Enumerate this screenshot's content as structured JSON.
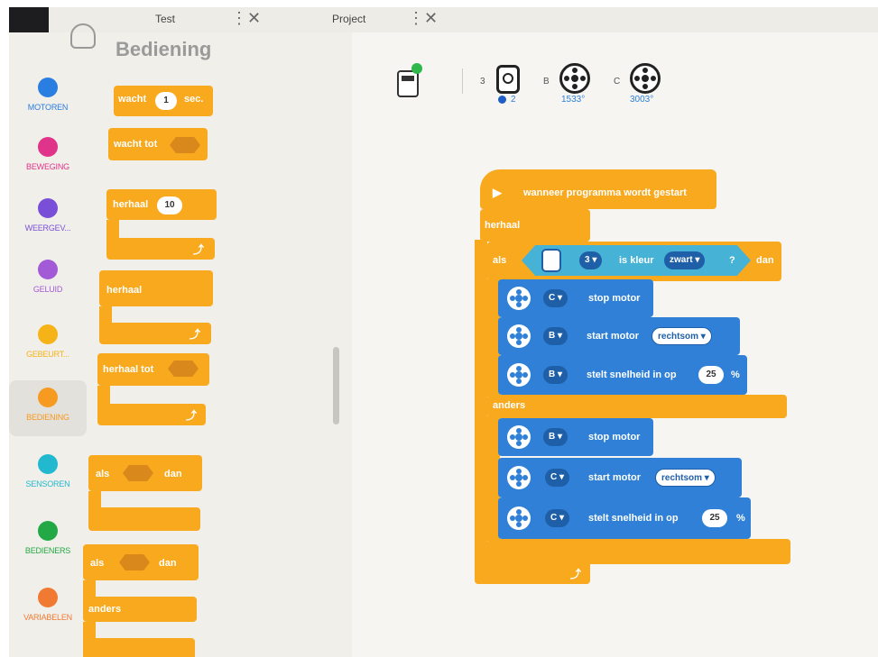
{
  "tabs": [
    {
      "label": "Test"
    },
    {
      "label": "Project"
    }
  ],
  "palette": {
    "title": "Bediening"
  },
  "categories": [
    {
      "label": "MOTOREN",
      "color": "#2a7de1"
    },
    {
      "label": "BEWEGING",
      "color": "#e0338a"
    },
    {
      "label": "WEERGEV...",
      "color": "#7a4fd8"
    },
    {
      "label": "GELUID",
      "color": "#a25ad6"
    },
    {
      "label": "GEBEURT...",
      "color": "#f5b317"
    },
    {
      "label": "BEDIENING",
      "color": "#f79a22"
    },
    {
      "label": "SENSOREN",
      "color": "#22b8cf"
    },
    {
      "label": "BEDIENERS",
      "color": "#22a845"
    },
    {
      "label": "VARIABELEN",
      "color": "#f07a32"
    }
  ],
  "palette_blocks": {
    "wait_label": "wacht",
    "wait_value": "1",
    "wait_unit": "sec.",
    "wait_until": "wacht tot",
    "repeat_label": "herhaal",
    "repeat_value": "10",
    "repeat_forever": "herhaal",
    "repeat_until": "herhaal tot",
    "if_label": "als",
    "then_label": "dan",
    "if2_label": "als",
    "then2_label": "dan",
    "else_label": "anders"
  },
  "ports": [
    {
      "letter": "3",
      "value": "2"
    },
    {
      "letter": "B",
      "value": "1533°"
    },
    {
      "letter": "C",
      "value": "3003°"
    }
  ],
  "program": {
    "start": "wanneer programma wordt gestart",
    "forever": "herhaal",
    "if": "als",
    "sensor_port": "3",
    "is_color": "is kleur",
    "color": "zwart",
    "question": "?",
    "then": "dan",
    "else": "anders",
    "blocks": [
      {
        "port": "C",
        "text": "stop motor"
      },
      {
        "port": "B",
        "text": "start motor",
        "dir": "rechtsom"
      },
      {
        "port": "B",
        "text": "stelt snelheid in op",
        "value": "25",
        "unit": "%"
      },
      {
        "port": "B",
        "text": "stop motor"
      },
      {
        "port": "C",
        "text": "start motor",
        "dir": "rechtsom"
      },
      {
        "port": "C",
        "text": "stelt snelheid in op",
        "value": "25",
        "unit": "%"
      }
    ]
  }
}
